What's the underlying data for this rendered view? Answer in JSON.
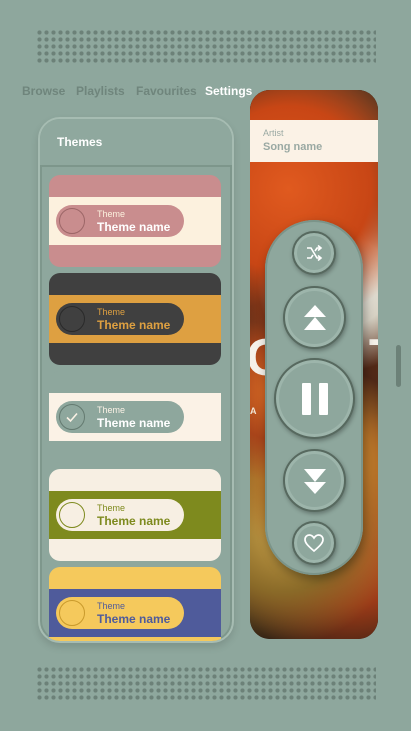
{
  "nav": {
    "tabs": [
      {
        "label": "Browse",
        "active": false
      },
      {
        "label": "Playlists",
        "active": false
      },
      {
        "label": "Favourites",
        "active": false
      },
      {
        "label": "Settings",
        "active": true
      }
    ]
  },
  "themes_panel": {
    "title": "Themes",
    "themes": [
      {
        "label": "Theme",
        "name": "Theme name",
        "selected": false,
        "colors": {
          "outer": "#c98d8e",
          "band": "#fcf1de",
          "toggle": "#c98d8e",
          "knob": "#c98d8e",
          "knob_border": "#9c6667",
          "text": "#ffffff",
          "label": "#fcf1de"
        }
      },
      {
        "label": "Theme",
        "name": "Theme name",
        "selected": false,
        "colors": {
          "outer": "#404040",
          "band": "#dea041",
          "toggle": "#404040",
          "knob": "#404040",
          "knob_border": "#2a2a2a",
          "text": "#dea041",
          "label": "#dea041"
        }
      },
      {
        "label": "Theme",
        "name": "Theme name",
        "selected": true,
        "colors": {
          "outer": "#8ea79d",
          "band": "#fbf2e6",
          "toggle": "#8ea79d",
          "knob": "#8ea79d",
          "knob_border": "#647a70",
          "text": "#ffffff",
          "label": "#fbf2e6"
        }
      },
      {
        "label": "Theme",
        "name": "Theme name",
        "selected": false,
        "colors": {
          "outer": "#f7efe3",
          "band": "#7e8a1e",
          "toggle": "#f7efe3",
          "knob": "#f7efe3",
          "knob_border": "#7e8a1e",
          "text": "#7e8a1e",
          "label": "#7e8a1e"
        }
      },
      {
        "label": "Theme",
        "name": "Theme name",
        "selected": false,
        "colors": {
          "outer": "#f5c95c",
          "band": "#4f5b9b",
          "toggle": "#f5c95c",
          "knob": "#f5c95c",
          "knob_border": "#c99a2c",
          "text": "#4f5b9b",
          "label": "#4f5b9b"
        }
      }
    ]
  },
  "player": {
    "artist_label": "Artist",
    "song_name": "Song name",
    "art_text": "O T",
    "art_subtext": "AT SO",
    "controls": [
      "shuffle-icon",
      "skip-previous-icon",
      "pause-icon",
      "skip-next-icon",
      "heart-icon"
    ]
  }
}
